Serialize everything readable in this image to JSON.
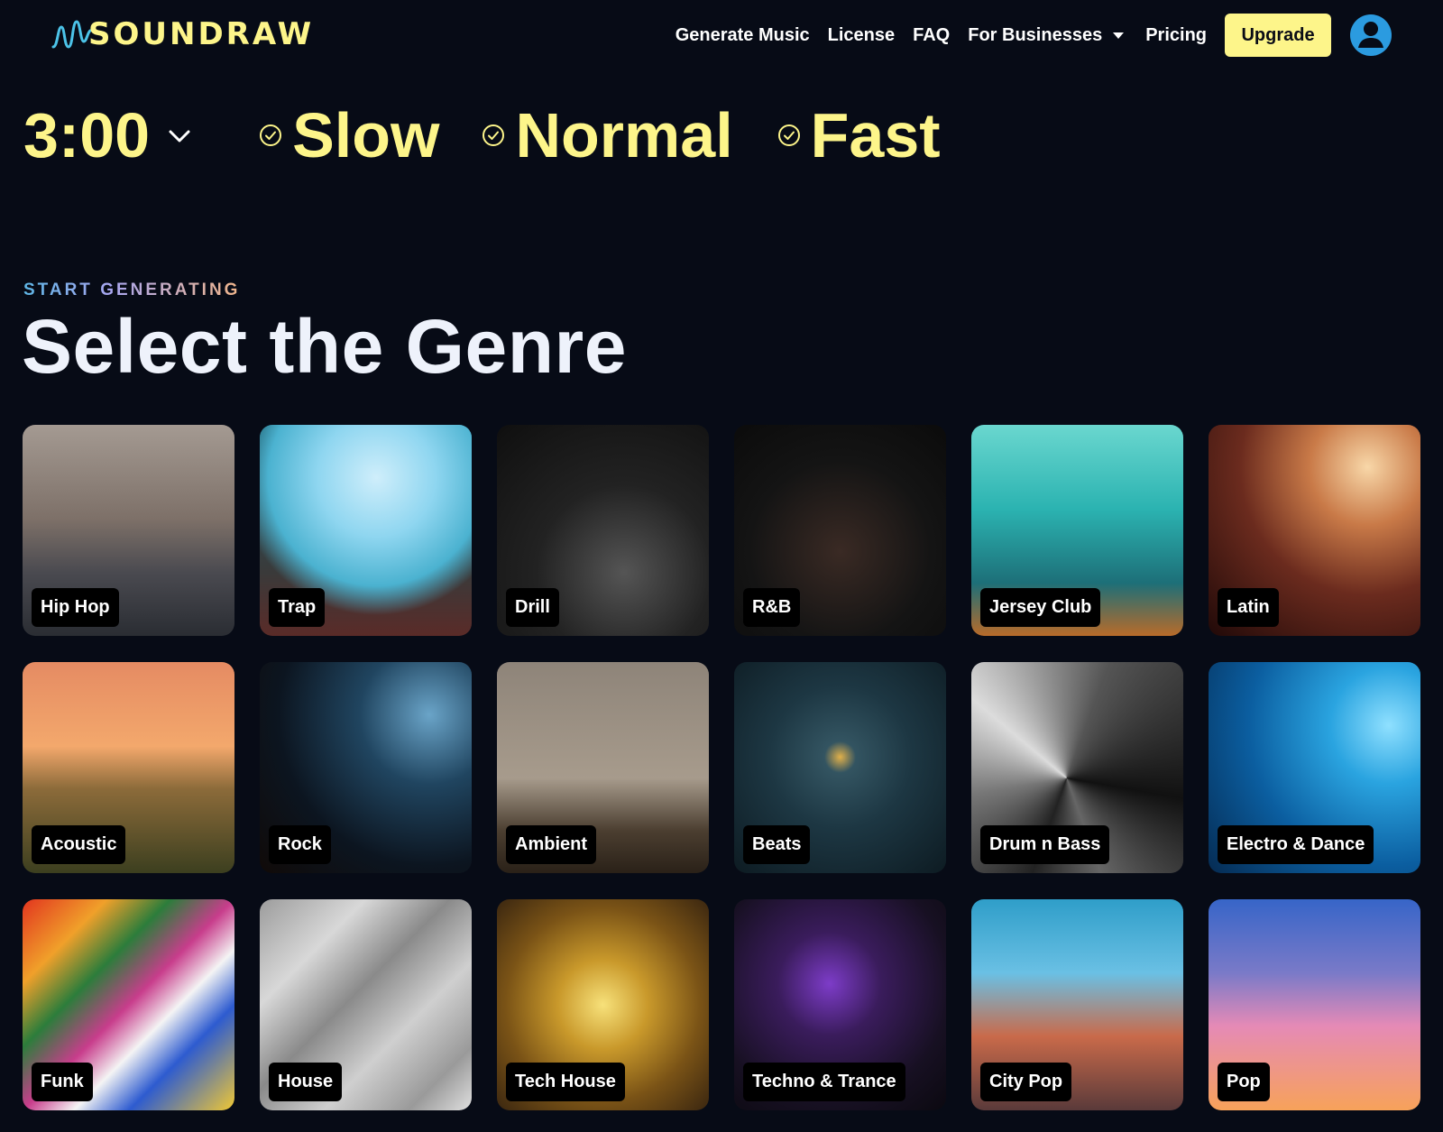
{
  "header": {
    "logo_text": "SOUNDRAW",
    "nav": {
      "generate_music": "Generate Music",
      "license": "License",
      "faq": "FAQ",
      "for_businesses": "For Businesses",
      "pricing": "Pricing"
    },
    "upgrade_label": "Upgrade"
  },
  "controls": {
    "duration": "3:00",
    "tempos": {
      "slow": "Slow",
      "normal": "Normal",
      "fast": "Fast"
    }
  },
  "section": {
    "eyebrow": "START GENERATING",
    "title": "Select the Genre"
  },
  "genres": [
    {
      "label": "Hip Hop"
    },
    {
      "label": "Trap"
    },
    {
      "label": "Drill"
    },
    {
      "label": "R&B"
    },
    {
      "label": "Jersey Club"
    },
    {
      "label": "Latin"
    },
    {
      "label": "Acoustic"
    },
    {
      "label": "Rock"
    },
    {
      "label": "Ambient"
    },
    {
      "label": "Beats"
    },
    {
      "label": "Drum n Bass"
    },
    {
      "label": "Electro & Dance"
    },
    {
      "label": "Funk"
    },
    {
      "label": "House"
    },
    {
      "label": "Tech House"
    },
    {
      "label": "Techno & Trance"
    },
    {
      "label": "City Pop"
    },
    {
      "label": "Pop"
    }
  ],
  "colors": {
    "background": "#070b16",
    "accent_yellow": "#fdf58a",
    "avatar_blue": "#2b9be0"
  },
  "icons": {
    "logo": "soundwave-logo-icon",
    "dropdown": "caret-down-icon",
    "duration": "chevron-down-icon",
    "tempo": "check-circle-icon",
    "account": "user-avatar-icon"
  }
}
